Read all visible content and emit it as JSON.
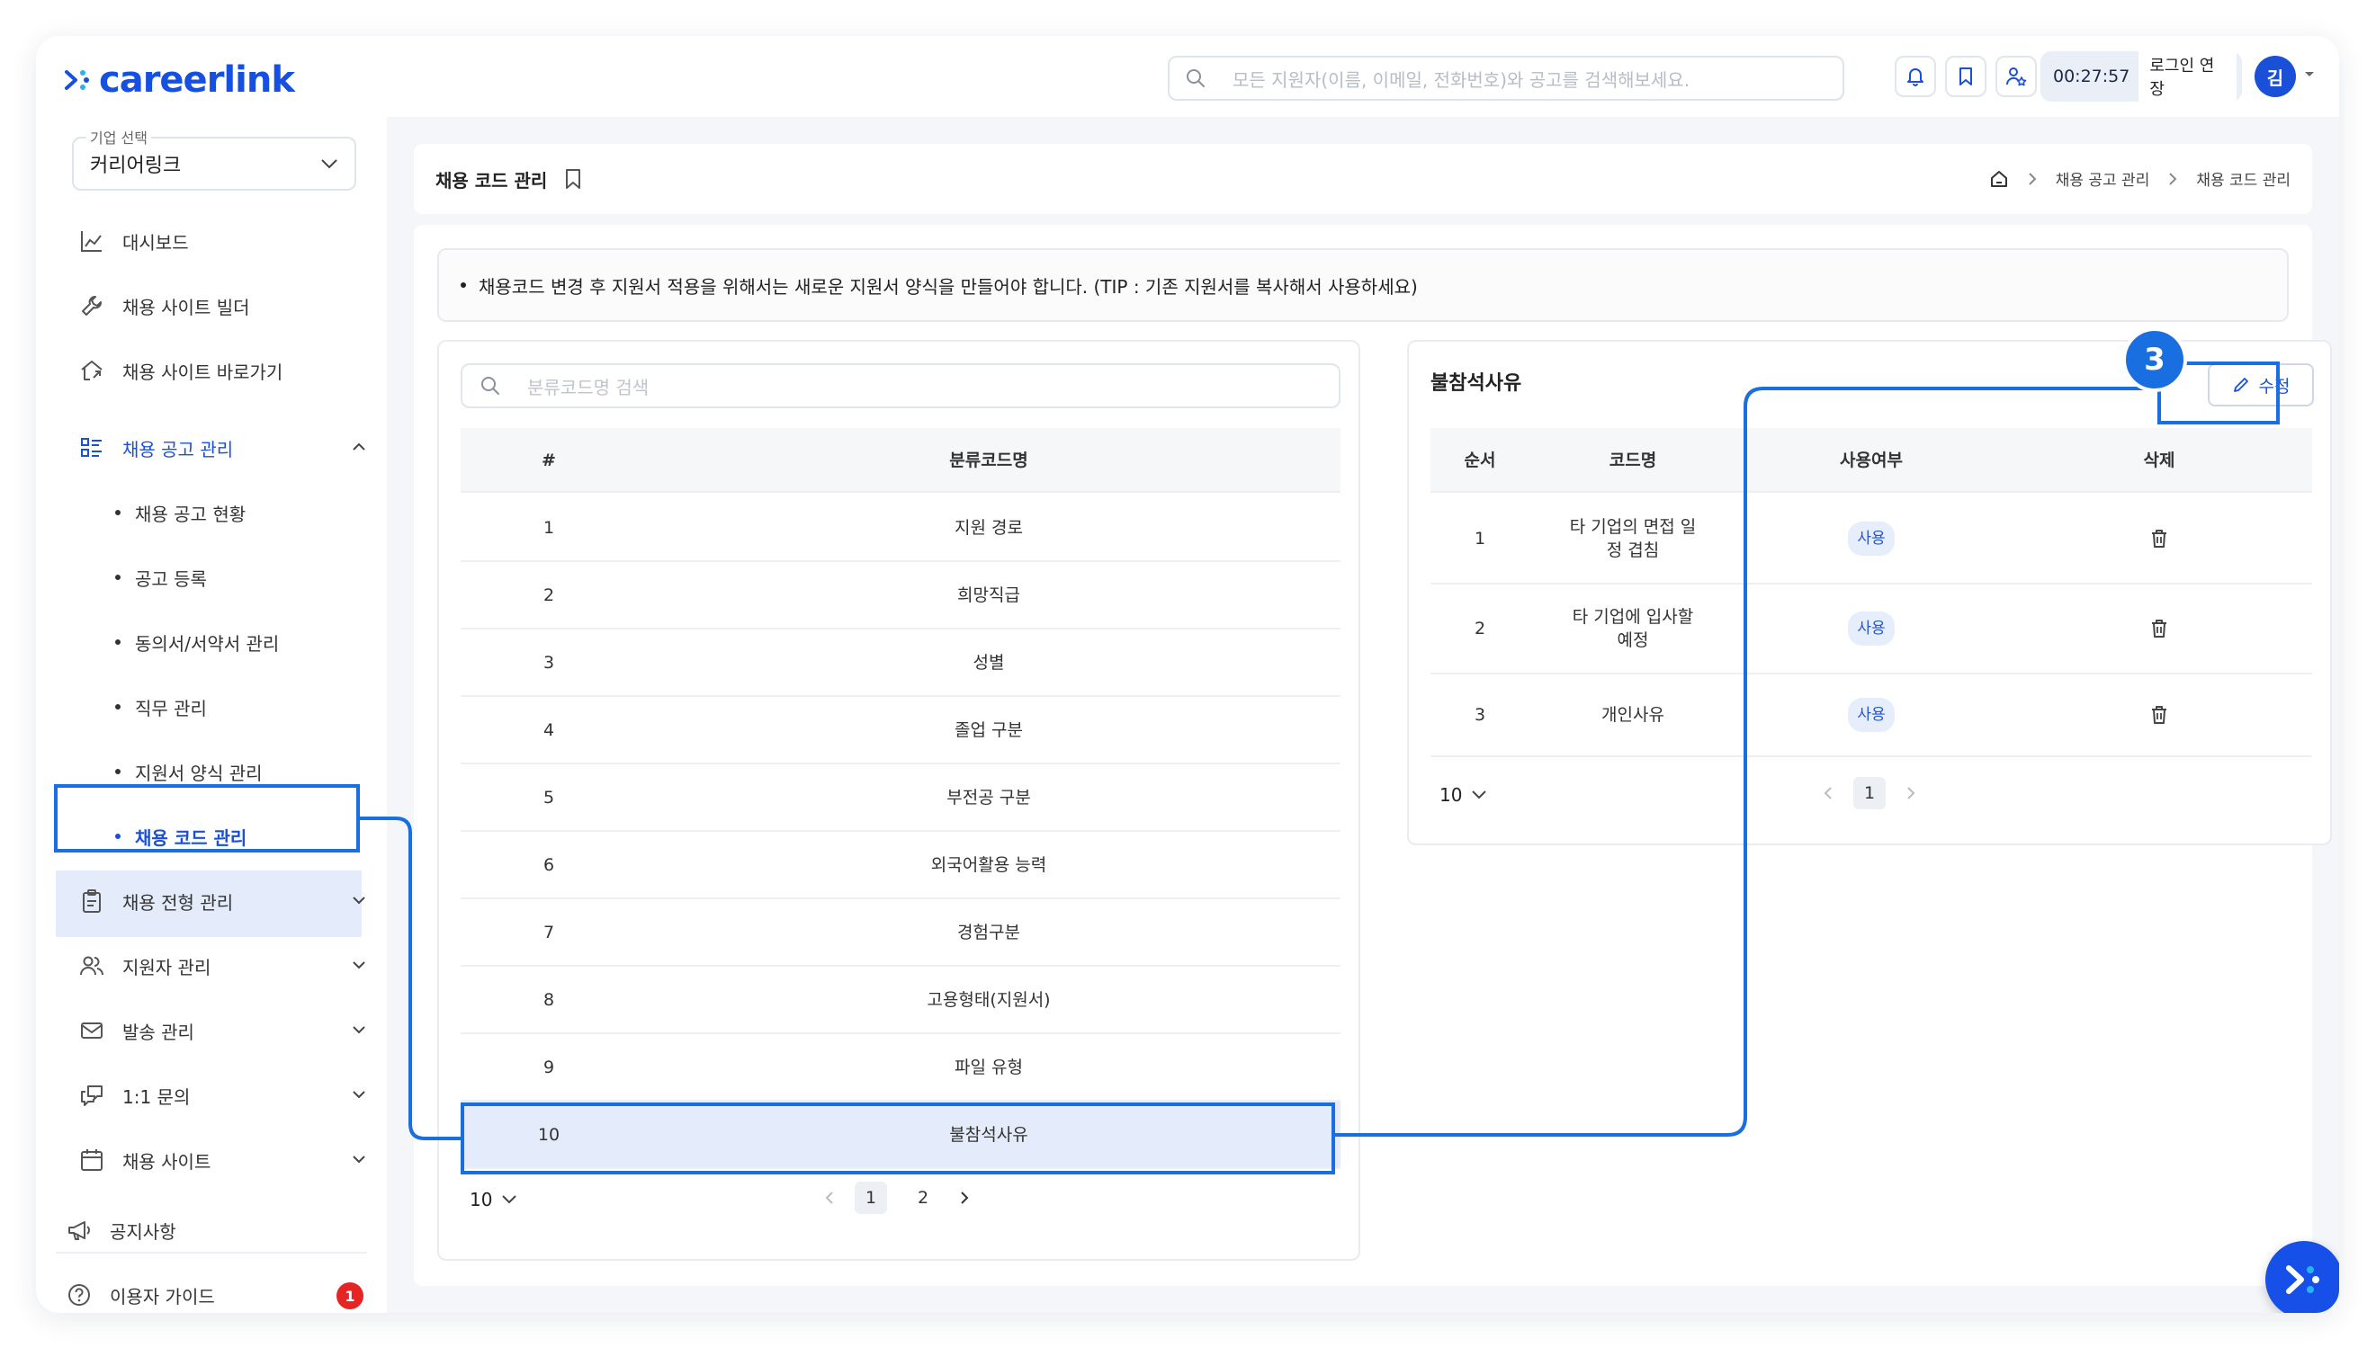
{
  "header": {
    "logo_text": "careerlink",
    "search_placeholder": "모든 지원자(이름, 이메일, 전화번호)와 공고를 검색해보세요.",
    "timer": "00:27:57",
    "extend_label": "로그인 연장",
    "avatar_initial": "김"
  },
  "sidebar": {
    "company_label": "기업 선택",
    "company_value": "커리어링크",
    "items": {
      "dashboard": "대시보드",
      "site_builder": "채용 사이트 빌더",
      "site_shortcut": "채용 사이트 바로가기",
      "job_post_mgmt": "채용 공고 관리",
      "selection_mgmt": "채용 전형 관리",
      "applicant_mgmt": "지원자 관리",
      "dispatch_mgmt": "발송 관리",
      "inquiry": "1:1 문의",
      "recruit_site": "채용 사이트",
      "notice": "공지사항",
      "guide": "이용자 가이드"
    },
    "sub_items": {
      "post_status": "채용 공고 현황",
      "post_register": "공고 등록",
      "consent_mgmt": "동의서/서약서 관리",
      "job_mgmt": "직무 관리",
      "form_mgmt": "지원서 양식 관리",
      "code_mgmt": "채용 코드 관리"
    },
    "notice_badge": "1"
  },
  "page": {
    "title": "채용 코드 관리",
    "breadcrumb": [
      "채용 공고 관리",
      "채용 코드 관리"
    ],
    "tip": "채용코드 변경 후 지원서 적용을 위해서는 새로운 지원서 양식을 만들어야 합니다. (TIP : 기존 지원서를 복사해서 사용하세요)"
  },
  "left_table": {
    "search_placeholder": "분류코드명 검색",
    "headers": [
      "#",
      "분류코드명"
    ],
    "rows": [
      {
        "num": "1",
        "name": "지원 경로"
      },
      {
        "num": "2",
        "name": "희망직급"
      },
      {
        "num": "3",
        "name": "성별"
      },
      {
        "num": "4",
        "name": "졸업 구분"
      },
      {
        "num": "5",
        "name": "부전공 구분"
      },
      {
        "num": "6",
        "name": "외국어활용 능력"
      },
      {
        "num": "7",
        "name": "경험구분"
      },
      {
        "num": "8",
        "name": "고용형태(지원서)"
      },
      {
        "num": "9",
        "name": "파일 유형"
      },
      {
        "num": "10",
        "name": "불참석사유"
      }
    ],
    "page_size": "10",
    "pages": [
      "1",
      "2"
    ]
  },
  "right_table": {
    "title": "불참석사유",
    "edit_label": "수정",
    "headers": [
      "순서",
      "코드명",
      "사용여부",
      "삭제"
    ],
    "rows": [
      {
        "order": "1",
        "name_line1": "타 기업의 면접 일",
        "name_line2": "정 겹침",
        "use": "사용"
      },
      {
        "order": "2",
        "name_line1": "타 기업에 입사할",
        "name_line2": "예정",
        "use": "사용"
      },
      {
        "order": "3",
        "name_line1": "개인사유",
        "name_line2": "",
        "use": "사용"
      }
    ],
    "page_size": "10",
    "pages": [
      "1"
    ]
  },
  "annotation": {
    "step": "3"
  },
  "colors": {
    "accent": "#1a6fe0",
    "brand": "#1650e0",
    "selected_row": "#e4ecfb",
    "badge": "#e52424"
  }
}
